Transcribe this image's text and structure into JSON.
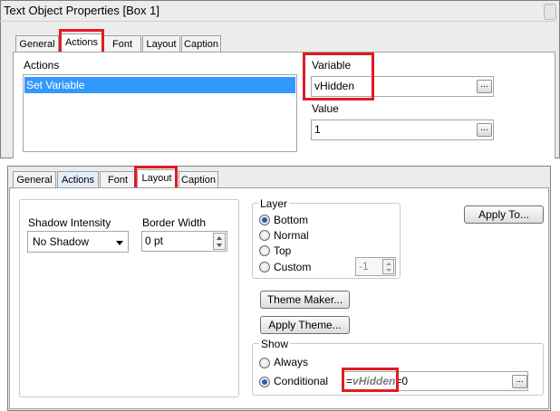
{
  "top_dialog": {
    "title": "Text Object Properties [Box 1]",
    "tabs": [
      "General",
      "Actions",
      "Font",
      "Layout",
      "Caption"
    ],
    "active_tab": "Actions",
    "actions_label": "Actions",
    "actions_list": [
      "Set Variable"
    ],
    "variable_label": "Variable",
    "variable_value": "vHidden",
    "value_label": "Value",
    "value_value": "1",
    "browse_label": "..."
  },
  "bottom_dialog": {
    "tabs": [
      "General",
      "Actions",
      "Font",
      "Layout",
      "Caption"
    ],
    "active_tab": "Layout",
    "shadow_intensity_label": "Shadow Intensity",
    "shadow_intensity_value": "No Shadow",
    "border_width_label": "Border Width",
    "border_width_value": "0 pt",
    "layer": {
      "label": "Layer",
      "options": [
        "Bottom",
        "Normal",
        "Top",
        "Custom"
      ],
      "selected": "Bottom",
      "custom_value": "-1"
    },
    "apply_to_label": "Apply To...",
    "theme_maker_label": "Theme Maker...",
    "apply_theme_label": "Apply Theme...",
    "show": {
      "label": "Show",
      "options": [
        "Always",
        "Conditional"
      ],
      "selected": "Conditional",
      "condition_prefix": "=",
      "condition_variable": "vHidden",
      "condition_suffix": "=0",
      "browse_label": "..."
    }
  },
  "colors": {
    "highlight_red": "#e21b23",
    "selection_blue": "#3399ff"
  }
}
